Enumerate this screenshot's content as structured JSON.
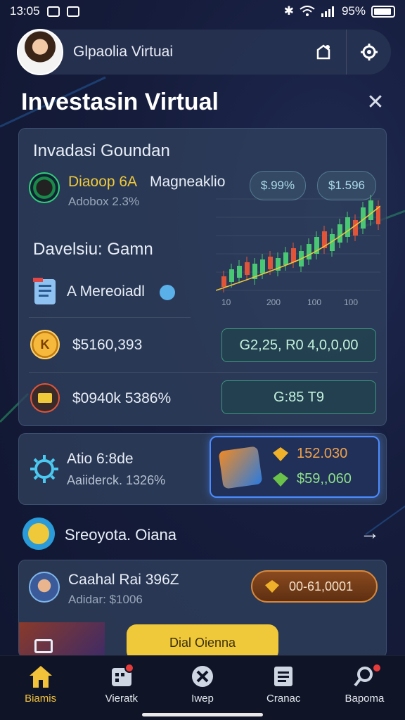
{
  "status_bar": {
    "time": "13:05",
    "battery": "95%"
  },
  "header": {
    "title": "Glpaolia Virtuai"
  },
  "page": {
    "title": "Investasin Virtual"
  },
  "main_card": {
    "heading": "Invadasi Goundan",
    "asset_name": "Diaoop 6A",
    "asset_desc": "Magneaklio",
    "asset_sub": "Adobox 2.3%",
    "pill_1": "$.99%",
    "pill_2": "$1.596",
    "section_2": "Davelsiu: Gamn",
    "doc_label": "A Mereoiadl",
    "chart_ticks": [
      "10",
      "200",
      "100",
      "100"
    ],
    "rows": [
      {
        "value": "$5160,393",
        "action": "G2,25, R0 4,0,0,00"
      },
      {
        "value": "$0940k 5386%",
        "action": "G:85 T9"
      }
    ]
  },
  "activity": {
    "title": "Atio 6:8de",
    "subtitle": "Aaiiderck. 1326%",
    "reward_1": "152.030",
    "reward_2": "$59,,060"
  },
  "section": {
    "title": "Sreoyota. Oiana"
  },
  "leader": {
    "name": "Caahal Rai 396Z",
    "sub": "Adidar: $1006",
    "button": "00-61,0001",
    "cta": "Dial Oienna"
  },
  "bottom_nav": [
    {
      "label": "Biamis",
      "active": true
    },
    {
      "label": "Vieratk",
      "active": false
    },
    {
      "label": "Iwep",
      "active": false
    },
    {
      "label": "Cranac",
      "active": false
    },
    {
      "label": "Bapoma",
      "active": false
    }
  ],
  "colors": {
    "accent": "#f3c23b",
    "up": "#49c774",
    "down": "#e0553a",
    "panel": "#2f405c"
  },
  "chart_data": {
    "type": "candlestick",
    "x_tick_labels": [
      "10",
      "200",
      "100",
      "100"
    ]
  }
}
